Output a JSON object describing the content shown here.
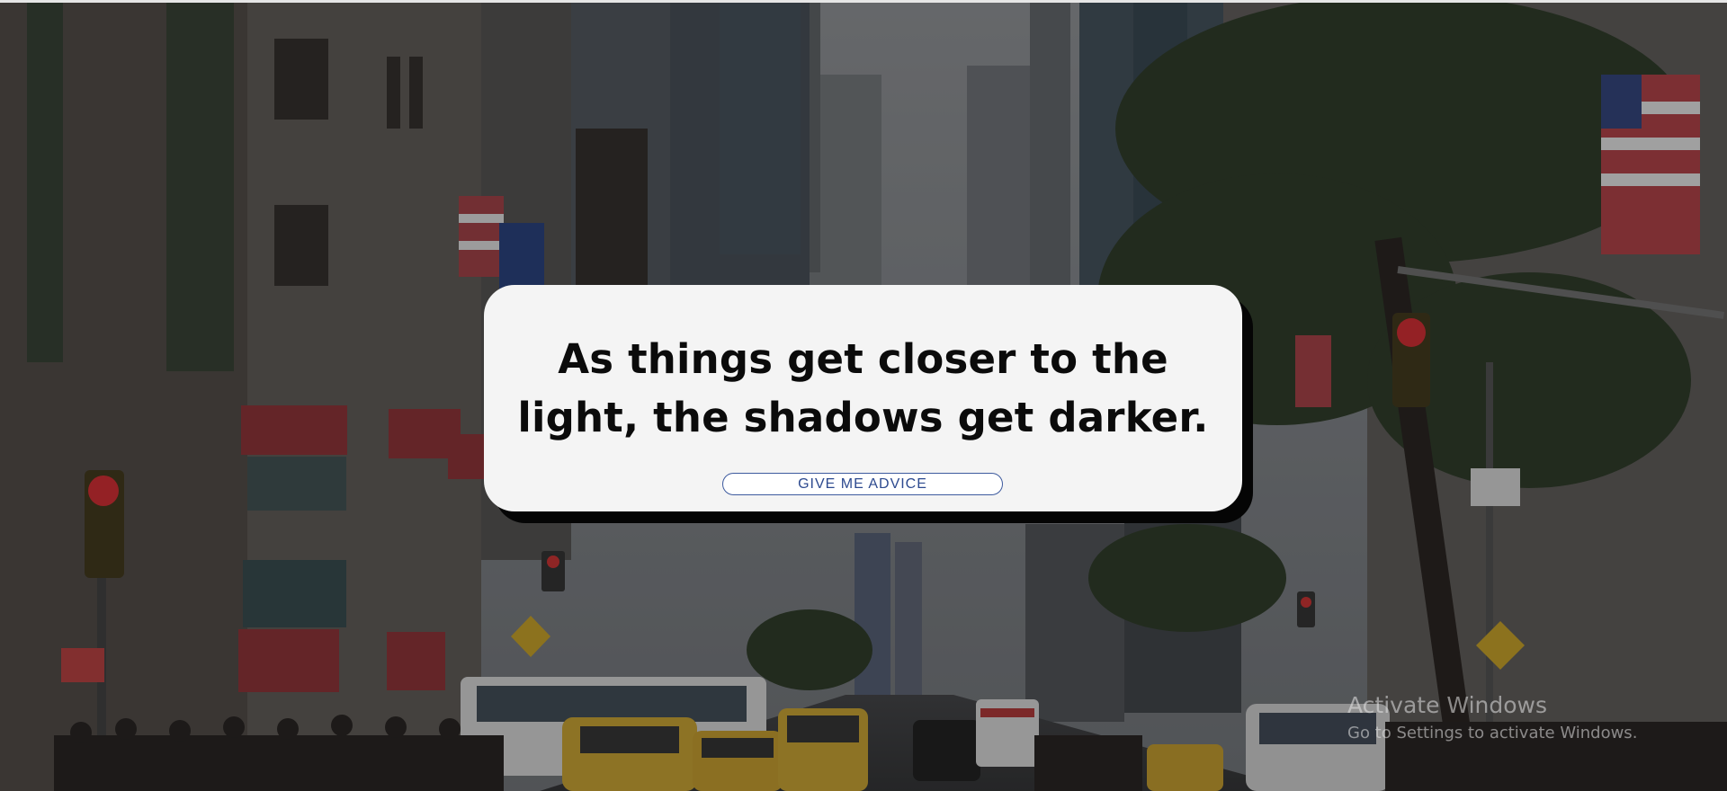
{
  "card": {
    "quote": "As things get closer to the light, the shadows get darker.",
    "button_label": "GIVE ME ADVICE"
  },
  "watermark": {
    "title": "Activate Windows",
    "subtitle": "Go to Settings to activate Windows."
  },
  "colors": {
    "card_background": "#f4f4f4",
    "card_shadow": "#050505",
    "quote_text": "#0b0b0b",
    "button_border": "#3d5a9e",
    "button_text": "#2d4a8f",
    "background_overlay": "#2c2c2c"
  },
  "background": {
    "scene": "city-street-photo"
  }
}
